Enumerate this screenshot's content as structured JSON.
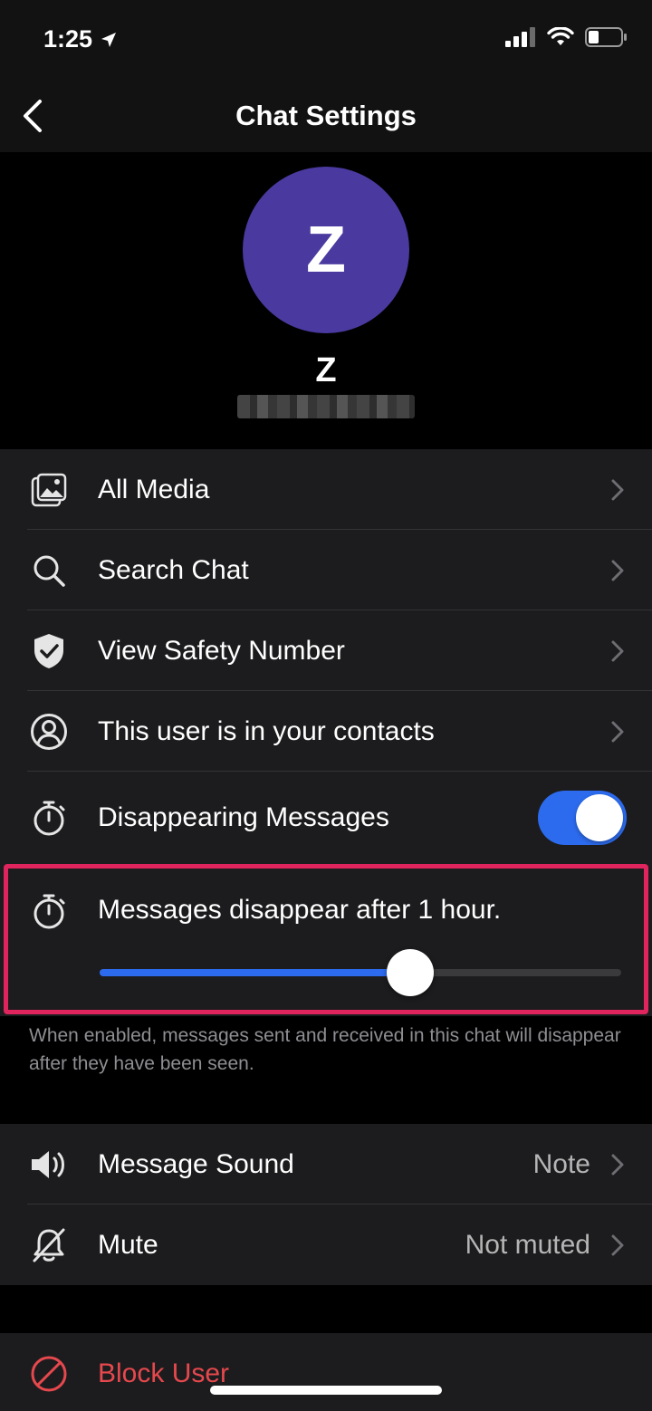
{
  "status_bar": {
    "time": "1:25"
  },
  "nav": {
    "title": "Chat Settings"
  },
  "profile": {
    "avatar_letter": "Z",
    "name": "Z",
    "avatar_color": "#4a3aa0"
  },
  "menu": {
    "all_media": "All Media",
    "search_chat": "Search Chat",
    "view_safety_number": "View Safety Number",
    "contact": "This user is in your contacts",
    "disappearing": "Disappearing Messages",
    "disappearing_enabled": true
  },
  "disappearing_timer": {
    "label": "Messages disappear after 1 hour.",
    "slider_fraction": 0.595
  },
  "footnote": "When enabled, messages sent and received in this chat will disappear after they have been seen.",
  "sound": {
    "message_sound_label": "Message Sound",
    "message_sound_value": "Note",
    "mute_label": "Mute",
    "mute_value": "Not muted"
  },
  "block": {
    "label": "Block User"
  },
  "colors": {
    "accent": "#2c6bed",
    "highlight": "#e0245e",
    "destructive": "#e5484d"
  }
}
